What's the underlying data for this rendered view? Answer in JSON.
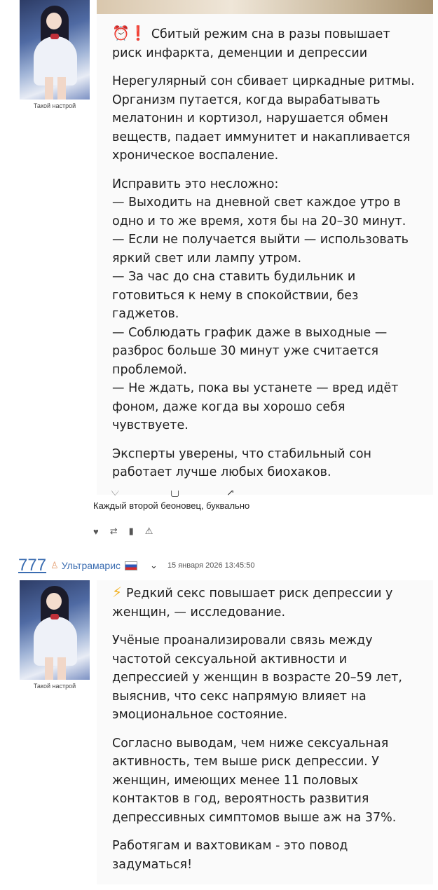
{
  "post1": {
    "avatar_caption": "Такой настрой",
    "headline_icon": "⏰❗",
    "headline": "Сбитый режим сна в разы повышает риск инфаркта, деменции и депрессии",
    "para1": "Нерегулярный сон сбивает циркадные ритмы. Организм путается, когда вырабатывать мелатонин и кортизол, нарушается обмен веществ, падает иммунитет и накапливается хроническое воспаление.",
    "para2_lines": [
      "Исправить это несложно:",
      "— Выходить на дневной свет каждое утро в одно и то же время, хотя бы на 20–30 минут.",
      "— Если не получается выйти — использовать яркий свет или лампу утром.",
      "— За час до сна ставить будильник и готовиться к нему в спокойствии, без гаджетов.",
      "— Соблюдать график даже в выходные — разброс больше 30 минут уже считается проблемой.",
      "— Не ждать, пока вы устанете — вред идёт фоном, даже когда вы хорошо себя чувствуете."
    ],
    "para3": "Эксперты уверены, что стабильный сон работает лучше любых биохаков.",
    "caption": "Каждый второй беоновец, буквально",
    "actions": {
      "like": "♥",
      "repost": "⇄",
      "bookmark": "▮",
      "report": "⚠"
    }
  },
  "post2": {
    "number": "777",
    "username": "Ультрамарис",
    "date": "15 января 2026 13:45:50",
    "chevron": "⌄",
    "avatar_caption": "Такой настрой",
    "headline_icon": "⚡",
    "headline": "Редкий секс повышает риск депрессии у женщин, — исследование.",
    "para1": "Учёные проанализировали связь между частотой сексуальной активности и депрессией у женщин в возрасте 20–59 лет, выяснив, что секс напрямую влияет на эмоциональное состояние.",
    "para2": "Согласно выводам, чем ниже сексуальная активность, тем выше риск депрессии. У женщин, имеющих менее 11 половых контактов в год, вероятность развития депрессивных симптомов выше аж на 37%.",
    "para3": "Работягам и вахтовикам - это повод задуматься!"
  }
}
